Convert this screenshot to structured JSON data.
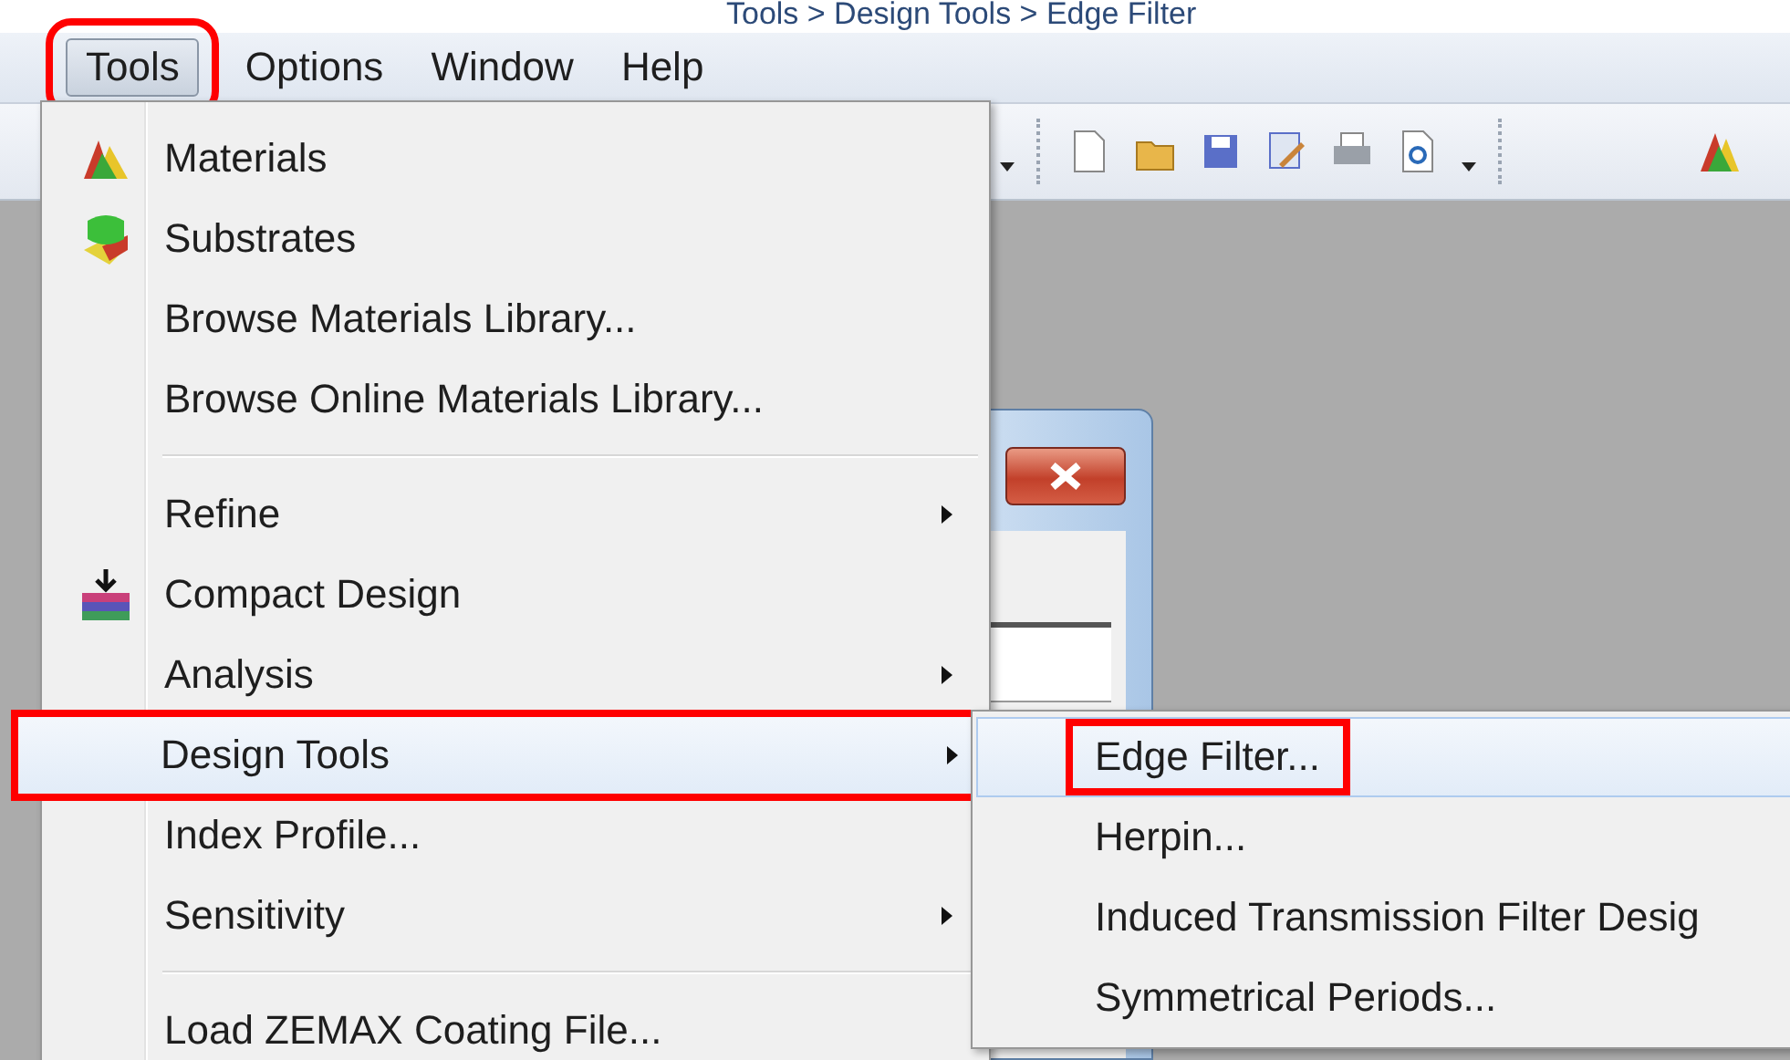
{
  "caption": "Tools > Design Tools > Edge Filter",
  "menubar": [
    {
      "label": "Tools",
      "selected": true,
      "annotated": true
    },
    {
      "label": "Options",
      "selected": false,
      "annotated": false
    },
    {
      "label": "Window",
      "selected": false,
      "annotated": false
    },
    {
      "label": "Help",
      "selected": false,
      "annotated": false
    }
  ],
  "tools_menu": [
    {
      "kind": "item",
      "label": "Materials",
      "submenu": false,
      "selected": false,
      "annotated": false
    },
    {
      "kind": "item",
      "label": "Substrates",
      "submenu": false,
      "selected": false,
      "annotated": false
    },
    {
      "kind": "item",
      "label": "Browse Materials Library...",
      "submenu": false,
      "selected": false,
      "annotated": false
    },
    {
      "kind": "item",
      "label": "Browse Online Materials Library...",
      "submenu": false,
      "selected": false,
      "annotated": false
    },
    {
      "kind": "separator"
    },
    {
      "kind": "item",
      "label": "Refine",
      "submenu": true,
      "selected": false,
      "annotated": false
    },
    {
      "kind": "item",
      "label": "Compact Design",
      "submenu": false,
      "selected": false,
      "annotated": false
    },
    {
      "kind": "item",
      "label": "Analysis",
      "submenu": true,
      "selected": false,
      "annotated": false
    },
    {
      "kind": "item",
      "label": "Design Tools",
      "submenu": true,
      "selected": true,
      "annotated": true
    },
    {
      "kind": "item",
      "label": "Index Profile...",
      "submenu": false,
      "selected": false,
      "annotated": false
    },
    {
      "kind": "item",
      "label": "Sensitivity",
      "submenu": true,
      "selected": false,
      "annotated": false
    },
    {
      "kind": "separator"
    },
    {
      "kind": "item",
      "label": "Load ZEMAX Coating File...",
      "submenu": false,
      "selected": false,
      "annotated": false
    }
  ],
  "design_tools_submenu": [
    {
      "label": "Edge Filter...",
      "selected": true,
      "annotated": true
    },
    {
      "label": "Herpin...",
      "selected": false,
      "annotated": false
    },
    {
      "label": "Induced Transmission Filter Desig",
      "selected": false,
      "annotated": false
    },
    {
      "label": "Symmetrical Periods...",
      "selected": false,
      "annotated": false
    }
  ]
}
